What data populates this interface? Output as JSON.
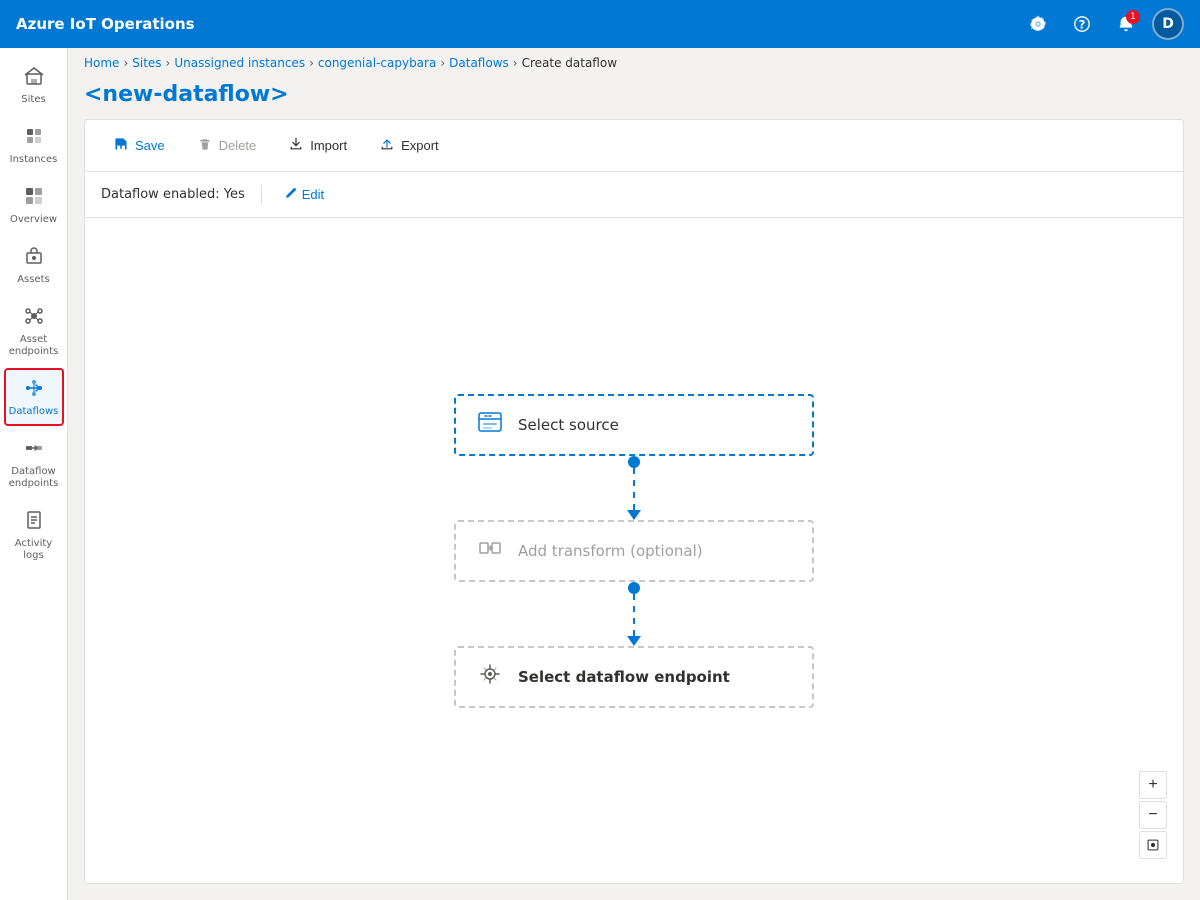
{
  "app": {
    "title": "Azure IoT Operations"
  },
  "topnav": {
    "title": "Azure IoT Operations",
    "icons": [
      "settings",
      "help",
      "notifications",
      "account"
    ],
    "notif_count": "1",
    "avatar_initials": "D"
  },
  "breadcrumb": {
    "items": [
      "Home",
      "Sites",
      "Unassigned instances",
      "congenial-capybara",
      "Dataflows"
    ],
    "current": "Create dataflow"
  },
  "page": {
    "title": "<new-dataflow>"
  },
  "toolbar": {
    "save_label": "Save",
    "delete_label": "Delete",
    "import_label": "Import",
    "export_label": "Export"
  },
  "dataflow": {
    "enabled_label": "Dataflow enabled: Yes",
    "edit_label": "Edit"
  },
  "flow_nodes": {
    "source": {
      "label": "Select source"
    },
    "transform": {
      "label": "Add transform (optional)"
    },
    "destination": {
      "label": "Select dataflow endpoint"
    }
  },
  "zoom": {
    "plus": "+",
    "minus": "−",
    "reset": "⊙"
  },
  "sidebar": {
    "items": [
      {
        "id": "sites",
        "label": "Sites",
        "icon": "🏢"
      },
      {
        "id": "instances",
        "label": "Instances",
        "icon": "⚙"
      },
      {
        "id": "overview",
        "label": "Overview",
        "icon": "▦"
      },
      {
        "id": "assets",
        "label": "Assets",
        "icon": "📦"
      },
      {
        "id": "asset-endpoints",
        "label": "Asset endpoints",
        "icon": "🔌"
      },
      {
        "id": "dataflows",
        "label": "Dataflows",
        "icon": "⇌",
        "active": true
      },
      {
        "id": "dataflow-endpoints",
        "label": "Dataflow endpoints",
        "icon": "⇆"
      },
      {
        "id": "activity-logs",
        "label": "Activity logs",
        "icon": "📋"
      }
    ]
  }
}
